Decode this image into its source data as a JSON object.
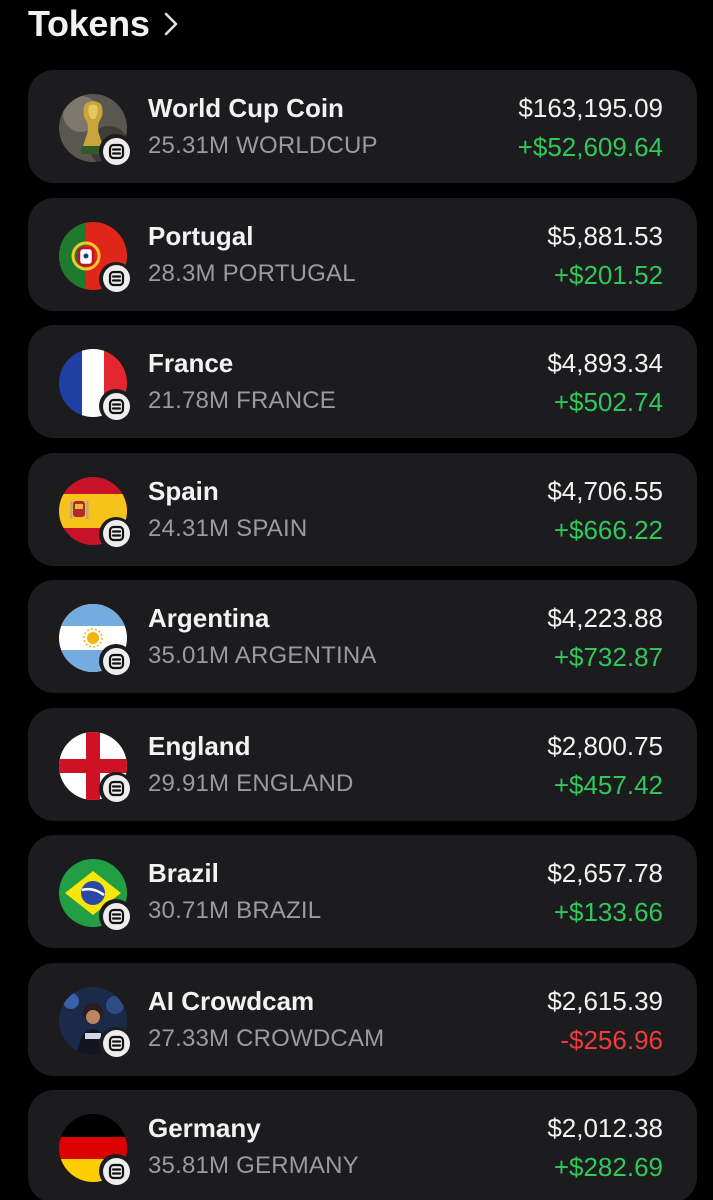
{
  "header": {
    "title": "Tokens",
    "chevron_icon": "chevron-right-icon"
  },
  "colors": {
    "background": "#000000",
    "card": "#1c1c1e",
    "positive": "#30c85a",
    "negative": "#ee3b3b",
    "secondary_text": "#9a9a9f"
  },
  "tokens": [
    {
      "name": "World Cup Coin",
      "holding": "25.31M WORLDCUP",
      "value": "$163,195.09",
      "change": "+$52,609.64",
      "direction": "up",
      "icon": "trophy-icon"
    },
    {
      "name": "Portugal",
      "holding": "28.3M PORTUGAL",
      "value": "$5,881.53",
      "change": "+$201.52",
      "direction": "up",
      "icon": "portugal-flag-icon"
    },
    {
      "name": "France",
      "holding": "21.78M FRANCE",
      "value": "$4,893.34",
      "change": "+$502.74",
      "direction": "up",
      "icon": "france-flag-icon"
    },
    {
      "name": "Spain",
      "holding": "24.31M SPAIN",
      "value": "$4,706.55",
      "change": "+$666.22",
      "direction": "up",
      "icon": "spain-flag-icon"
    },
    {
      "name": "Argentina",
      "holding": "35.01M ARGENTINA",
      "value": "$4,223.88",
      "change": "+$732.87",
      "direction": "up",
      "icon": "argentina-flag-icon"
    },
    {
      "name": "England",
      "holding": "29.91M ENGLAND",
      "value": "$2,800.75",
      "change": "+$457.42",
      "direction": "up",
      "icon": "england-flag-icon"
    },
    {
      "name": "Brazil",
      "holding": "30.71M BRAZIL",
      "value": "$2,657.78",
      "change": "+$133.66",
      "direction": "up",
      "icon": "brazil-flag-icon"
    },
    {
      "name": "AI Crowdcam",
      "holding": "27.33M CROWDCAM",
      "value": "$2,615.39",
      "change": "-$256.96",
      "direction": "down",
      "icon": "crowd-photo-icon"
    },
    {
      "name": "Germany",
      "holding": "35.81M GERMANY",
      "value": "$2,012.38",
      "change": "+$282.69",
      "direction": "up",
      "icon": "germany-flag-icon"
    }
  ]
}
